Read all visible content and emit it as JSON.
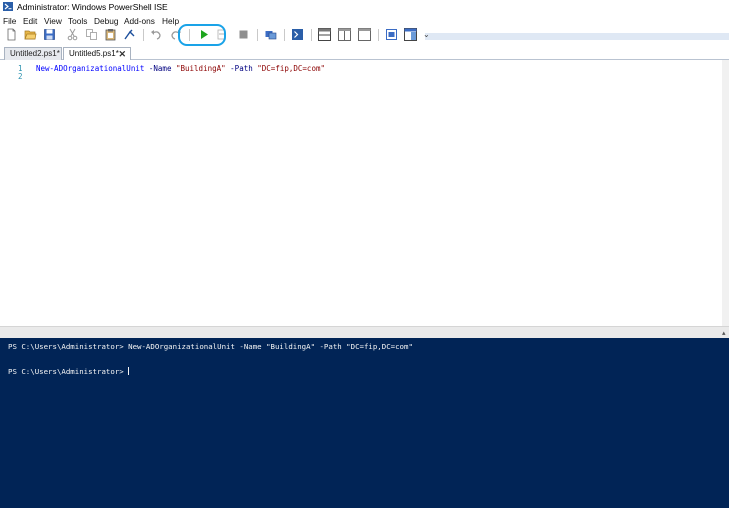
{
  "window": {
    "title": "Administrator: Windows PowerShell ISE"
  },
  "menu": [
    "File",
    "Edit",
    "View",
    "Tools",
    "Debug",
    "Add-ons",
    "Help"
  ],
  "toolbar": {
    "buttons": [
      "new-script",
      "open",
      "save",
      "cut",
      "copy",
      "paste",
      "clear-console",
      "undo",
      "redo",
      "run-script",
      "run-selection",
      "stop",
      "new-remote-tab",
      "start-powershell",
      "show-script-top",
      "show-script-right",
      "show-script-maximized",
      "show-command-window",
      "show-command-addon"
    ],
    "overflow": "⌄"
  },
  "tabs": [
    {
      "label": "Untitled2.ps1*"
    },
    {
      "label": "Untitled5.ps1*",
      "close": "✕"
    }
  ],
  "editor": {
    "line_numbers": [
      "1",
      "2"
    ],
    "line1": {
      "cmd": "New-ADOrganizationalUnit",
      "p1": "-Name",
      "s1": "\"BuildingA\"",
      "p2": "-Path",
      "s2": "\"DC=fip,DC=com\""
    }
  },
  "console": {
    "line1": "PS C:\\Users\\Administrator> New-ADOrganizationalUnit -Name \"BuildingA\" -Path \"DC=fip,DC=com\"",
    "line2": "PS C:\\Users\\Administrator> "
  },
  "colors": {
    "console_bg": "#012456",
    "highlight": "#1aa3e8",
    "run_button": "#1ea51e"
  }
}
